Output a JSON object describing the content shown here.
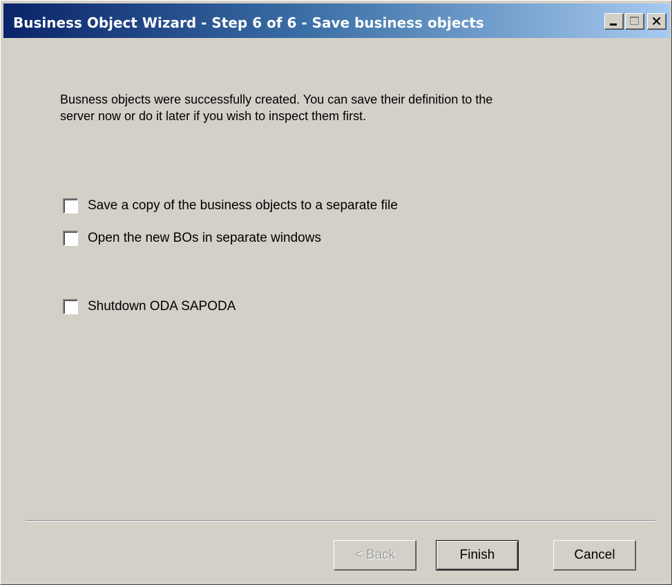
{
  "window": {
    "title": "Business Object Wizard - Step 6 of 6 - Save business objects",
    "controls": {
      "minimize": "minimize-icon",
      "maximize": "maximize-icon",
      "close": "close-icon"
    }
  },
  "main": {
    "description_line1": "Busness objects were successfully created. You can save their definition to the",
    "description_line2": "server now or do it later if you wish to inspect them first.",
    "options": [
      {
        "label": "Save a copy of the business objects to a separate file",
        "checked": false
      },
      {
        "label": "Open the new BOs in separate windows",
        "checked": false
      },
      {
        "label": "Shutdown ODA SAPODA",
        "checked": false
      }
    ]
  },
  "footer": {
    "back_label": "< Back",
    "back_enabled": false,
    "finish_label": "Finish",
    "cancel_label": "Cancel"
  },
  "colors": {
    "title_gradient_start": "#0a246a",
    "title_gradient_end": "#a6caf0",
    "dialog_bg": "#d4d0c8"
  }
}
